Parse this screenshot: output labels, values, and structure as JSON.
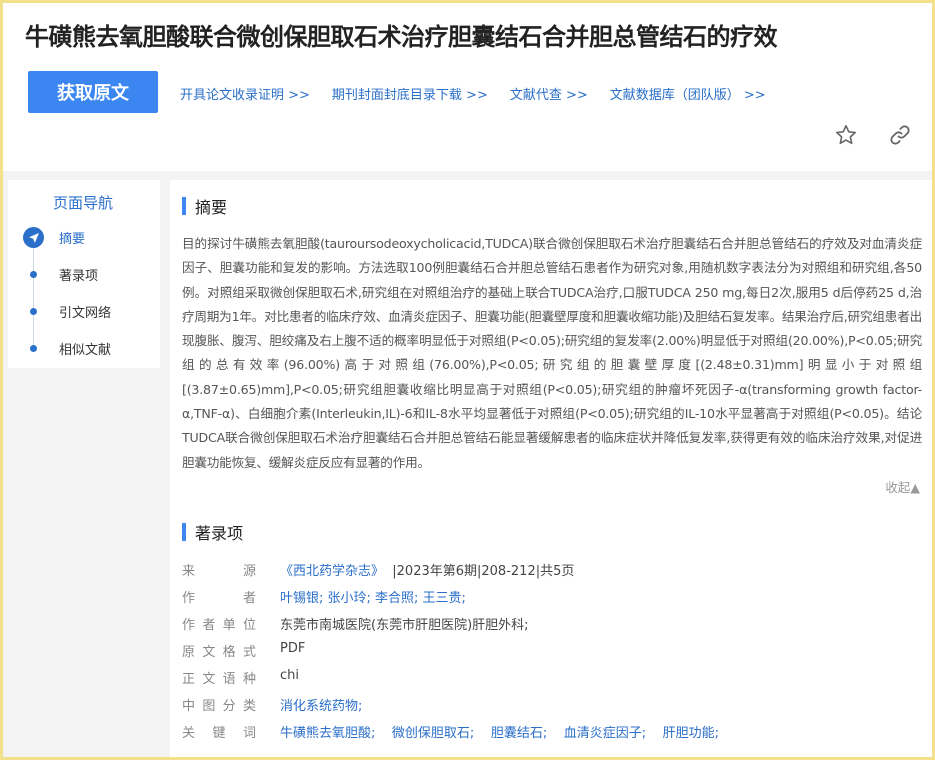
{
  "header": {
    "title": "牛磺熊去氧胆酸联合微创保胆取石术治疗胆囊结石合并胆总管结石的疗效",
    "fulltext_button": "获取原文",
    "links": [
      "开具论文收录证明 >>",
      "期刊封面封底目录下载 >>",
      "文献代查 >>",
      "文献数据库（团队版） >>"
    ],
    "icons": [
      "star-icon",
      "link-icon"
    ]
  },
  "nav": {
    "title": "页面导航",
    "items": [
      "摘要",
      "著录项",
      "引文网络",
      "相似文献"
    ],
    "active_index": 0
  },
  "abstract": {
    "heading": "摘要",
    "text": "目的探讨牛磺熊去氧胆酸(tauroursodeoxycholicacid,TUDCA)联合微创保胆取石术治疗胆囊结石合并胆总管结石的疗效及对血清炎症因子、胆囊功能和复发的影响。方法选取100例胆囊结石合并胆总管结石患者作为研究对象,用随机数字表法分为对照组和研究组,各50例。对照组采取微创保胆取石术,研究组在对照组治疗的基础上联合TUDCA治疗,口服TUDCA 250 mg,每日2次,服用5 d后停药25 d,治疗周期为1年。对比患者的临床疗效、血清炎症因子、胆囊功能(胆囊壁厚度和胆囊收缩功能)及胆结石复发率。结果治疗后,研究组患者出现腹胀、腹泻、胆绞痛及右上腹不适的概率明显低于对照组(P<0.05);研究组的复发率(2.00%)明显低于对照组(20.00%),P<0.05;研究组的总有效率(96.00%)高于对照组(76.00%),P<0.05;研究组的胆囊壁厚度[(2.48±0.31)mm]明显小于对照组[(3.87±0.65)mm],P<0.05;研究组胆囊收缩比明显高于对照组(P<0.05);研究组的肿瘤坏死因子-α(transforming growth factor-α,TNF-α)、白细胞介素(Interleukin,IL)-6和IL-8水平均显著低于对照组(P<0.05);研究组的IL-10水平显著高于对照组(P<0.05)。结论TUDCA联合微创保胆取石术治疗胆囊结石合并胆总管结石能显著缓解患者的临床症状并降低复发率,获得更有效的临床治疗效果,对促进胆囊功能恢复、缓解炎症反应有显著的作用。",
    "collapse_label": "收起▲"
  },
  "record": {
    "heading": "著录项",
    "rows": [
      {
        "key": "来源",
        "parts": [
          {
            "t": "《西北药学杂志》",
            "link": true
          },
          {
            "t": "  |2023年第6期|208-212|共5页",
            "link": false
          }
        ]
      },
      {
        "key": "作者",
        "parts": [
          {
            "t": "叶锡银; 张小玲; 李合照; 王三贵;",
            "link": true
          }
        ]
      },
      {
        "key": "作者单位",
        "parts": [
          {
            "t": "东莞市南城医院(东莞市肝胆医院)肝胆外科;",
            "link": false
          }
        ]
      },
      {
        "key": "原文格式",
        "parts": [
          {
            "t": "PDF",
            "link": false
          }
        ]
      },
      {
        "key": "正文语种",
        "parts": [
          {
            "t": "chi",
            "link": false
          }
        ]
      },
      {
        "key": "中图分类",
        "parts": [
          {
            "t": "消化系统药物;",
            "link": true
          }
        ]
      },
      {
        "key": "关键词",
        "parts": [
          {
            "t": "牛磺熊去氧胆酸;    微创保胆取石;    胆囊结石;    血清炎症因子;    肝胆功能;",
            "link": true
          }
        ]
      }
    ]
  },
  "colors": {
    "accent": "#3b86f0",
    "link": "#2a6fc9",
    "frame": "#f2e08a"
  }
}
